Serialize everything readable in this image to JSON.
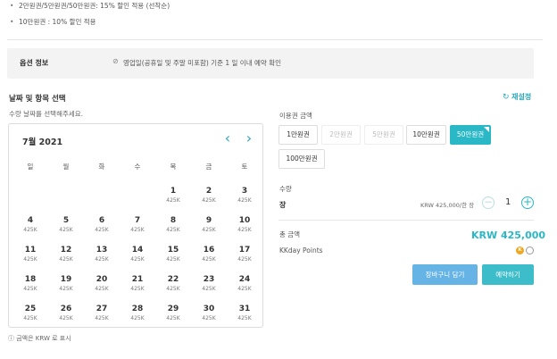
{
  "notes": [
    "2만원권/5만원권/50만원권: 15% 할인 적용 (선착순)",
    "10만원권 : 10% 할인 적용"
  ],
  "option_info": {
    "title": "옵션 정보",
    "text": "영업일(공휴일 및 주말 미포함) 기준 1 일 이내 예약 확인"
  },
  "date_section": {
    "title": "날짜 및 항목 선택",
    "subtitle": "수량 날짜를 선택해주세요.",
    "reset_label": "재설정"
  },
  "calendar": {
    "month_label": "7월 2021",
    "weekdays": [
      "일",
      "월",
      "화",
      "수",
      "목",
      "금",
      "토"
    ],
    "days": [
      [
        "",
        "",
        "",
        "",
        "1",
        "2",
        "3"
      ],
      [
        "4",
        "5",
        "6",
        "7",
        "8",
        "9",
        "10"
      ],
      [
        "11",
        "12",
        "13",
        "14",
        "15",
        "16",
        "17"
      ],
      [
        "18",
        "19",
        "20",
        "21",
        "22",
        "23",
        "24"
      ],
      [
        "25",
        "26",
        "27",
        "28",
        "29",
        "30",
        "31"
      ]
    ],
    "price_label": "425K"
  },
  "footnote": "금액은 KRW 로 표시",
  "voucher": {
    "title": "이용권 금액",
    "options": [
      {
        "label": "1만원권",
        "state": "normal"
      },
      {
        "label": "2만원권",
        "state": "disabled"
      },
      {
        "label": "5만원권",
        "state": "disabled"
      },
      {
        "label": "10만원권",
        "state": "normal"
      },
      {
        "label": "50만원권",
        "state": "selected"
      },
      {
        "label": "100만원권",
        "state": "normal"
      }
    ]
  },
  "quantity": {
    "title": "수량",
    "unit": "장",
    "unit_price": "KRW 425,000/한 장",
    "value": "1",
    "minus": "−",
    "plus": "+"
  },
  "total": {
    "label": "총 금액",
    "value": "KRW 425,000",
    "points_label": "KKday Points",
    "points_badge": "K"
  },
  "actions": {
    "cart_label": "장바구니 담기",
    "book_label": "예약하기"
  },
  "colors": {
    "accent": "#2ab7c6",
    "cart_button": "#66b3e6",
    "book_button": "#3dbdc9",
    "points_badge": "#f2a51f"
  }
}
